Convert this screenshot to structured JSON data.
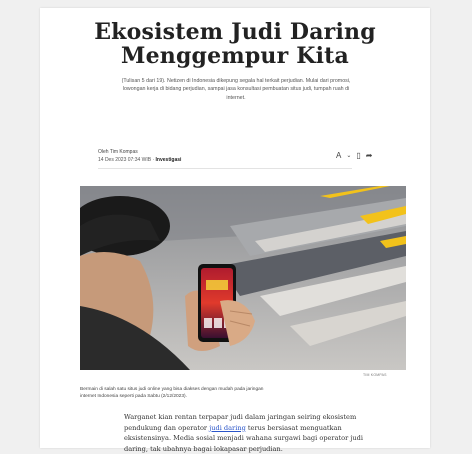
{
  "article": {
    "title_line1": "Ekosistem Judi Daring",
    "title_line2": "Menggempur Kita",
    "subtitle": "(Tulisan 5 dari 19). Netizen di Indonesia dikepung segala hal terkait perjudian. Mulai dari promosi, lowongan kerja di bidang perjudian, sampai jasa konsultasi pembuatan situs judi, tumpah ruah di internet.",
    "author": "Oleh Tim Kompas",
    "date": "14 Des 2023 07:34 WIB",
    "meta_sep": " · ",
    "category": "Investigasi",
    "tools": {
      "font_size": "A",
      "font_chevron": "⌄",
      "bookmark": "▯",
      "share": "➦"
    },
    "image_credit": "TIM KOMPAS",
    "caption": "Bermain di salah satu situs judi online yang bisa diakses dengan mudah pada jaringan internet Indonesia seperti pada Sabtu (2/12/2023).",
    "body_before_link": "Warganet kian rentan terpapar judi dalam jaringan seiring ekosistem pendukung dan operator ",
    "body_link": "judi daring",
    "body_after_link": " terus bersiasat menguatkan eksistensinya. Media sosial menjadi wahana surgawi bagi operator judi daring, tak ubahnya bagai lokapasar perjudian."
  },
  "colors": {
    "link": "#2a55c9",
    "title": "#222222",
    "accent_stripe": "#f2c21b"
  }
}
